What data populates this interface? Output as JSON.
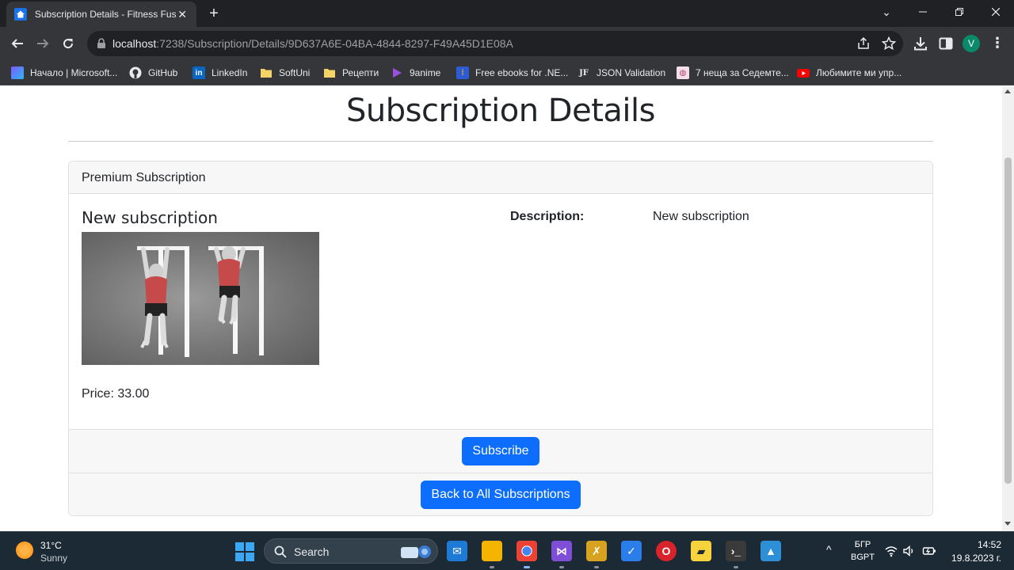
{
  "browser": {
    "tab_title": "Subscription Details - Fitness Fusion",
    "url_host": "localhost",
    "url_path": ":7238/Subscription/Details/9D637A6E-04BA-4844-8297-F49A45D1E08A",
    "profile_initial": "V",
    "bookmarks": [
      {
        "label": "Начало | Microsoft...",
        "icon": "microsoft-365-icon",
        "color": "#7b5cff"
      },
      {
        "label": "GitHub",
        "icon": "github-icon",
        "color": "#ffffff"
      },
      {
        "label": "LinkedIn",
        "icon": "linkedin-icon",
        "color": "#0a66c2"
      },
      {
        "label": "SoftUni",
        "icon": "folder-icon",
        "color": "#f6d365"
      },
      {
        "label": "Рецепти",
        "icon": "folder-icon",
        "color": "#f6d365"
      },
      {
        "label": "9anime",
        "icon": "play-icon",
        "color": "#9b51e0"
      },
      {
        "label": "Free ebooks for .NE...",
        "icon": "ebook-icon",
        "color": "#2d5bd6"
      },
      {
        "label": "JSON Validation",
        "icon": "jf-icon",
        "color": "#202124"
      },
      {
        "label": "7 неща за Седемте...",
        "icon": "article-icon",
        "color": "#e8b4c8"
      },
      {
        "label": "Любимите ми упр...",
        "icon": "youtube-icon",
        "color": "#ff0000"
      }
    ]
  },
  "page": {
    "title": "Subscription Details",
    "card_header": "Premium Subscription",
    "subscription_name": "New subscription",
    "image_alt": "Pull-up exercise illustration",
    "price_text": "Price: 33.00",
    "description_label": "Description:",
    "description_value": "New subscription",
    "subscribe_label": "Subscribe",
    "back_label": "Back to All Subscriptions",
    "accent_color": "#0d6efd"
  },
  "taskbar": {
    "weather_temp": "31°C",
    "weather_desc": "Sunny",
    "search_label": "Search",
    "lang_line1": "БГР",
    "lang_line2": "BGPT",
    "time": "14:52",
    "date": "19.8.2023 г."
  }
}
